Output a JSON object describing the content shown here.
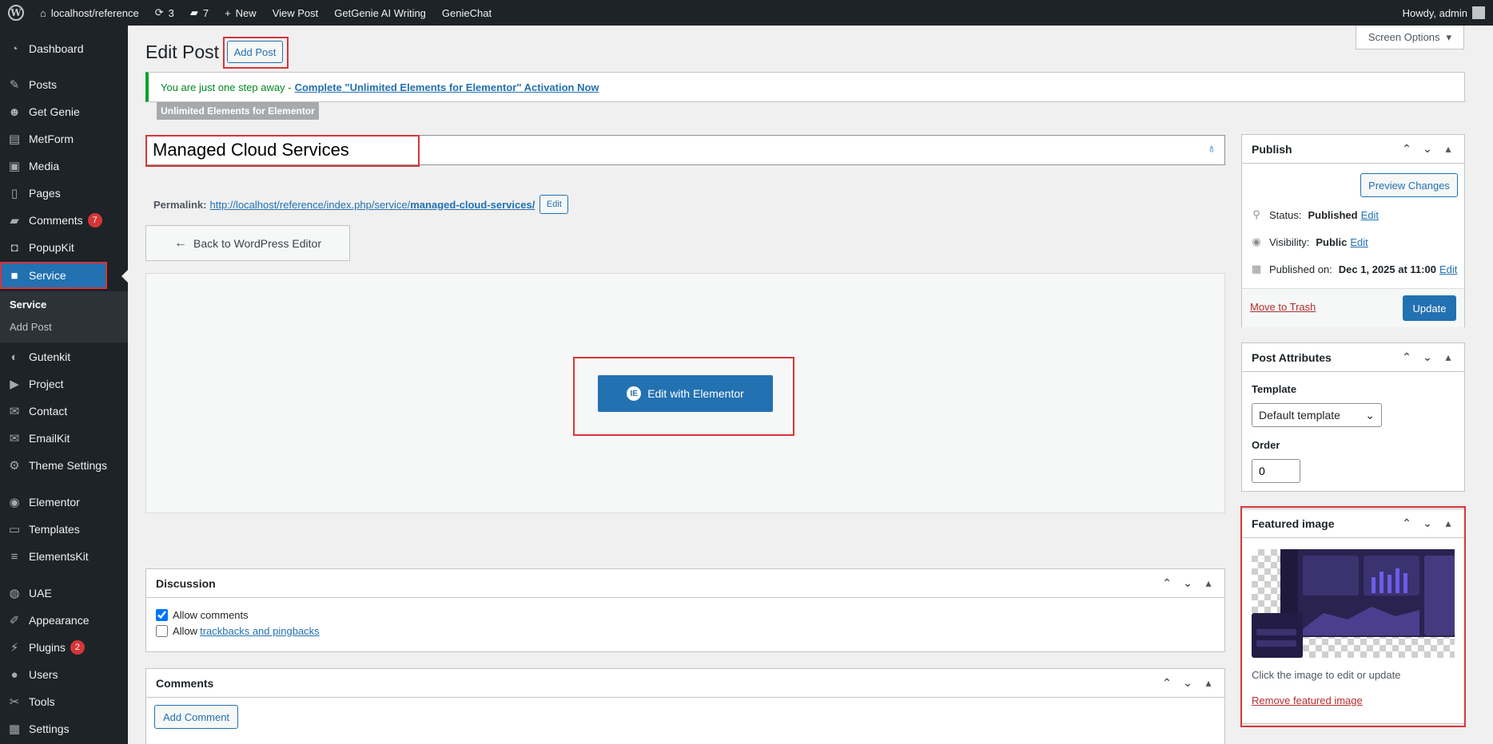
{
  "admin_bar": {
    "site_name": "localhost/reference",
    "updates_count": "3",
    "comments_count": "7",
    "new_label": "New",
    "view_post": "View Post",
    "genie_writing": "GetGenie AI Writing",
    "genie_chat": "GenieChat",
    "howdy": "Howdy, admin"
  },
  "sidebar": {
    "items": [
      {
        "label": "Dashboard",
        "icon": "dashboard-icon"
      },
      {
        "label": "Posts",
        "icon": "pin-icon"
      },
      {
        "label": "Get Genie",
        "icon": "genie-icon"
      },
      {
        "label": "MetForm",
        "icon": "form-icon"
      },
      {
        "label": "Media",
        "icon": "media-icon"
      },
      {
        "label": "Pages",
        "icon": "pages-icon"
      },
      {
        "label": "Comments",
        "icon": "comment-icon",
        "badge": "7"
      },
      {
        "label": "PopupKit",
        "icon": "popup-icon"
      },
      {
        "label": "Service",
        "icon": "camera-icon"
      },
      {
        "label": "Gutenkit",
        "icon": "gutenkit-icon"
      },
      {
        "label": "Project",
        "icon": "project-icon"
      },
      {
        "label": "Contact",
        "icon": "mail-icon"
      },
      {
        "label": "EmailKit",
        "icon": "emailkit-icon"
      },
      {
        "label": "Theme Settings",
        "icon": "gear-icon"
      },
      {
        "label": "Elementor",
        "icon": "elementor-icon"
      },
      {
        "label": "Templates",
        "icon": "folder-icon"
      },
      {
        "label": "ElementsKit",
        "icon": "elementskit-icon"
      },
      {
        "label": "UAE",
        "icon": "uae-icon"
      },
      {
        "label": "Appearance",
        "icon": "brush-icon"
      },
      {
        "label": "Plugins",
        "icon": "plugin-icon",
        "badge": "2"
      },
      {
        "label": "Users",
        "icon": "user-icon"
      },
      {
        "label": "Tools",
        "icon": "wrench-icon"
      },
      {
        "label": "Settings",
        "icon": "settings-icon"
      }
    ],
    "submenu": [
      "Service",
      "Add Post"
    ]
  },
  "header": {
    "title": "Edit Post",
    "add_post": "Add Post",
    "screen_options": "Screen Options"
  },
  "notice": {
    "text": "You are just one step away - ",
    "link": "Complete \"Unlimited Elements for Elementor\" Activation Now",
    "tag": "Unlimited Elements for Elementor"
  },
  "post": {
    "title": "Managed Cloud Services",
    "permalink_label": "Permalink:",
    "permalink_base": "http://localhost/reference/index.php/service/",
    "permalink_slug": "managed-cloud-services/",
    "edit_label": "Edit"
  },
  "editor": {
    "back_label": "Back to WordPress Editor",
    "elementor_label": "Edit with Elementor"
  },
  "discussion": {
    "title": "Discussion",
    "allow_comments": "Allow comments",
    "allow_prefix": "Allow",
    "trackbacks_link": "trackbacks and pingbacks",
    "allow_comments_checked": true,
    "trackbacks_checked": false
  },
  "comments_box": {
    "title": "Comments",
    "add_comment": "Add Comment"
  },
  "publish": {
    "title": "Publish",
    "preview": "Preview Changes",
    "status_label": "Status:",
    "status_value": "Published",
    "visibility_label": "Visibility:",
    "visibility_value": "Public",
    "published_label": "Published on:",
    "published_value": "Dec 1, 2025 at 11:00",
    "edit": "Edit",
    "trash": "Move to Trash",
    "update": "Update"
  },
  "attributes": {
    "title": "Post Attributes",
    "template_label": "Template",
    "template_value": "Default template",
    "order_label": "Order",
    "order_value": "0"
  },
  "featured": {
    "title": "Featured image",
    "hint": "Click the image to edit or update",
    "remove": "Remove featured image"
  },
  "colors": {
    "admin_bar": "#1d2327",
    "accent": "#2271b1",
    "highlight_box": "#d63638",
    "notice_border": "#00a32a"
  }
}
